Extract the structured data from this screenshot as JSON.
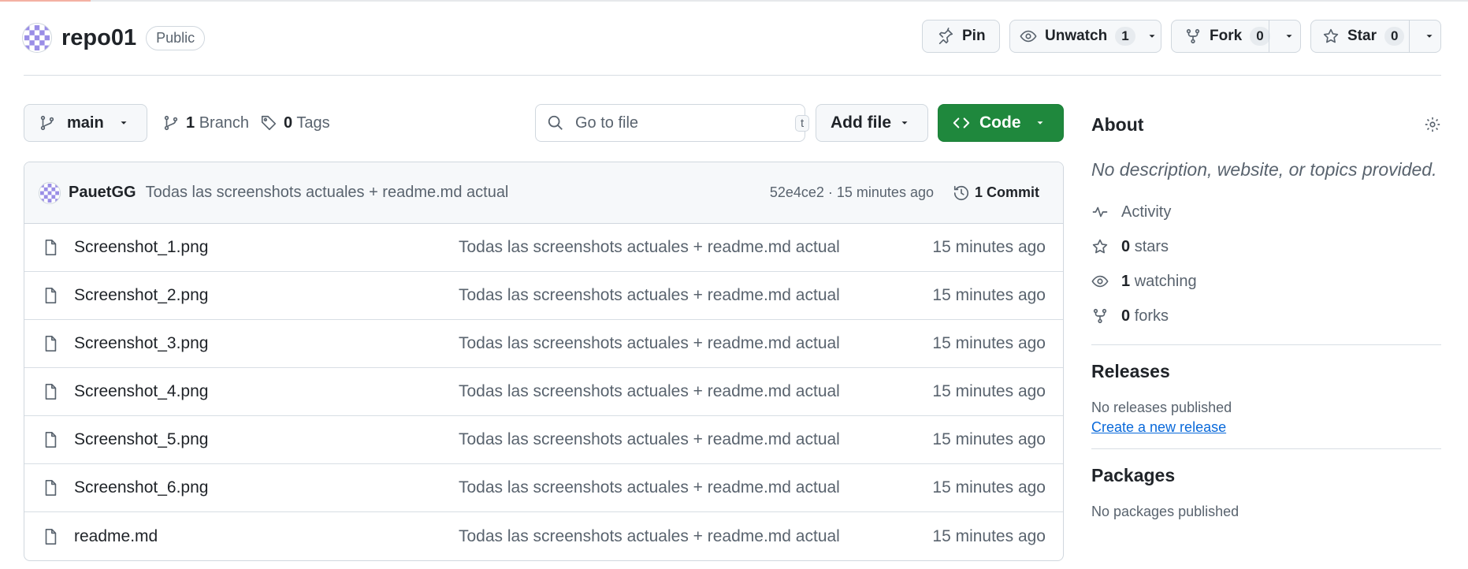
{
  "repo": {
    "name": "repo01",
    "visibility": "Public"
  },
  "actions": {
    "pin_label": "Pin",
    "unwatch_label": "Unwatch",
    "unwatch_count": "1",
    "fork_label": "Fork",
    "fork_count": "0",
    "star_label": "Star",
    "star_count": "0"
  },
  "toolbar": {
    "branch": "main",
    "branch_count": "1",
    "branch_word": "Branch",
    "tag_count": "0",
    "tag_word": "Tags",
    "search_placeholder": "Go to file",
    "search_shortcut": "t",
    "add_file_label": "Add file",
    "code_label": "Code"
  },
  "commit": {
    "author": "PauetGG",
    "message": "Todas las screenshots actuales + readme.md actual",
    "hash_time": "52e4ce2 · 15 minutes ago",
    "count_label": "1 Commit"
  },
  "files": [
    {
      "name": "Screenshot_1.png",
      "message": "Todas las screenshots actuales + readme.md actual",
      "time": "15 minutes ago"
    },
    {
      "name": "Screenshot_2.png",
      "message": "Todas las screenshots actuales + readme.md actual",
      "time": "15 minutes ago"
    },
    {
      "name": "Screenshot_3.png",
      "message": "Todas las screenshots actuales + readme.md actual",
      "time": "15 minutes ago"
    },
    {
      "name": "Screenshot_4.png",
      "message": "Todas las screenshots actuales + readme.md actual",
      "time": "15 minutes ago"
    },
    {
      "name": "Screenshot_5.png",
      "message": "Todas las screenshots actuales + readme.md actual",
      "time": "15 minutes ago"
    },
    {
      "name": "Screenshot_6.png",
      "message": "Todas las screenshots actuales + readme.md actual",
      "time": "15 minutes ago"
    },
    {
      "name": "readme.md",
      "message": "Todas las screenshots actuales + readme.md actual",
      "time": "15 minutes ago"
    }
  ],
  "about": {
    "title": "About",
    "description": "No description, website, or topics provided.",
    "activity_label": "Activity",
    "stars_count": "0",
    "stars_word": "stars",
    "watching_count": "1",
    "watching_word": "watching",
    "forks_count": "0",
    "forks_word": "forks"
  },
  "releases": {
    "title": "Releases",
    "empty": "No releases published",
    "create_link": "Create a new release"
  },
  "packages": {
    "title": "Packages",
    "empty": "No packages published"
  },
  "colors": {
    "code_button": "#1f883d",
    "link": "#0969da",
    "muted_text": "#59636e",
    "border": "#d0d7de"
  },
  "icons": [
    "identicon-avatar",
    "pin-icon",
    "eye-icon",
    "fork-icon",
    "star-icon",
    "chevron-down-icon",
    "branch-icon",
    "tag-icon",
    "search-icon",
    "code-icon",
    "history-icon",
    "file-icon",
    "gear-icon",
    "pulse-icon"
  ]
}
